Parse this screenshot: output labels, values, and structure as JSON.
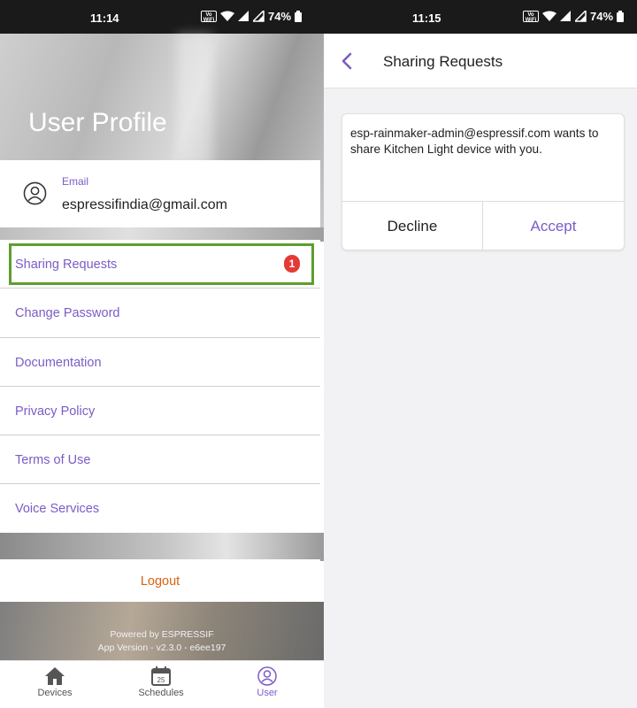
{
  "left_screen": {
    "status_bar": {
      "time": "11:14",
      "vowifi": "VoWiFi",
      "battery": "74%"
    },
    "header": {
      "title": "User Profile"
    },
    "email": {
      "label": "Email",
      "value": "espressifindia@gmail.com"
    },
    "menu": [
      {
        "label": "Sharing Requests",
        "badge": "1"
      },
      {
        "label": "Change Password"
      },
      {
        "label": "Documentation"
      },
      {
        "label": "Privacy Policy"
      },
      {
        "label": "Terms of Use"
      },
      {
        "label": "Voice Services"
      }
    ],
    "logout": "Logout",
    "footer": {
      "powered_by": "Powered by ESPRESSIF",
      "app_version": "App Version - v2.3.0 - e6ee197"
    },
    "tabs": [
      {
        "label": "Devices",
        "icon": "home-icon"
      },
      {
        "label": "Schedules",
        "icon": "calendar-icon",
        "day": "25"
      },
      {
        "label": "User",
        "icon": "user-icon"
      }
    ]
  },
  "right_screen": {
    "status_bar": {
      "time": "11:15",
      "vowifi": "VoWiFi",
      "battery": "74%"
    },
    "app_bar": {
      "title": "Sharing Requests"
    },
    "request": {
      "message": "esp-rainmaker-admin@espressif.com wants to share Kitchen Light device with you.",
      "decline": "Decline",
      "accept": "Accept"
    }
  },
  "colors": {
    "accent": "#7b5cc7",
    "logout": "#d9620f",
    "badge": "#e53935",
    "highlight": "#5e9e2f"
  }
}
